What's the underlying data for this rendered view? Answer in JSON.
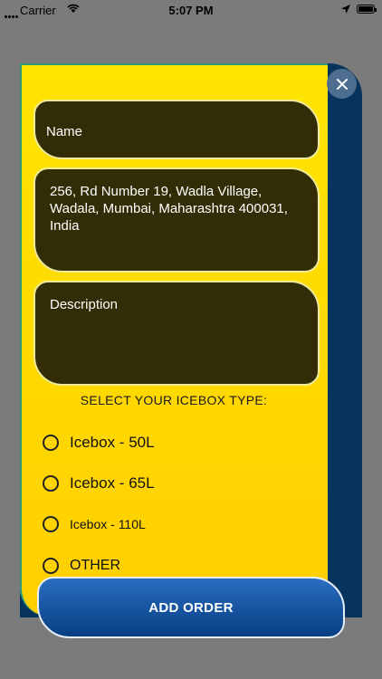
{
  "status_bar": {
    "carrier": "Carrier",
    "time": "5:07 PM"
  },
  "form": {
    "name_placeholder": "Name",
    "address_value": "256, Rd Number 19, Wadla Village, Wadala, Mumbai, Maharashtra 400031, India",
    "description_placeholder": "Description",
    "icebox_section_title": "SELECT YOUR ICEBOX TYPE:",
    "icebox_options": [
      {
        "label": "Icebox - 50L",
        "selected": false
      },
      {
        "label": "Icebox - 65L",
        "selected": false
      },
      {
        "label": "Icebox - 110L",
        "selected": false
      },
      {
        "label": "OTHER",
        "selected": false
      }
    ],
    "submit_label": "ADD ORDER"
  },
  "icons": {
    "close": "close-icon",
    "radio": "radio-unchecked-icon"
  },
  "colors": {
    "panel": "#ffd800",
    "field_bg": "#322d06",
    "back_panel": "#06345c",
    "button": "#0a4b92"
  }
}
